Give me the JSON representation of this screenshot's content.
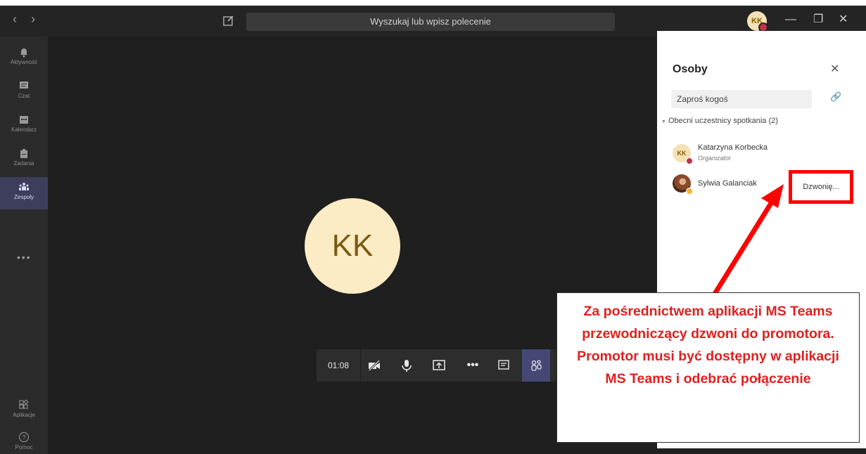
{
  "window": {
    "search_placeholder": "Wyszukaj lub wpisz polecenie",
    "user_initials": "KK"
  },
  "rail": {
    "items": [
      {
        "label": "Aktywność",
        "icon": "bell-icon"
      },
      {
        "label": "Czat",
        "icon": "chat-icon"
      },
      {
        "label": "Kalendarz",
        "icon": "calendar-icon"
      },
      {
        "label": "Zadania",
        "icon": "tasks-icon"
      },
      {
        "label": "Zespoły",
        "icon": "teams-icon"
      }
    ],
    "more": "•••",
    "apps_label": "Aplikacje",
    "help_label": "Pomoc"
  },
  "call": {
    "avatar_initials": "KK",
    "time": "01:08"
  },
  "panel": {
    "title": "Osoby",
    "invite_placeholder": "Zaproś kogoś",
    "section_label": "Obecni uczestnicy spotkania (2)",
    "participants": [
      {
        "initials": "KK",
        "name": "Katarzyna Korbecka",
        "role": "Organizator",
        "status_color": "#c4314b"
      },
      {
        "name": "Sylwia Galanciak",
        "status": "Dzwonię...",
        "status_color": "#fbb034"
      }
    ]
  },
  "annotation": {
    "callout_text": "Za pośrednictwem aplikacji MS Teams przewodniczący dzwoni do promotora. Promotor musi być dostępny w aplikacji MS Teams i odebrać połączenie",
    "highlight_color": "#ff0000"
  }
}
